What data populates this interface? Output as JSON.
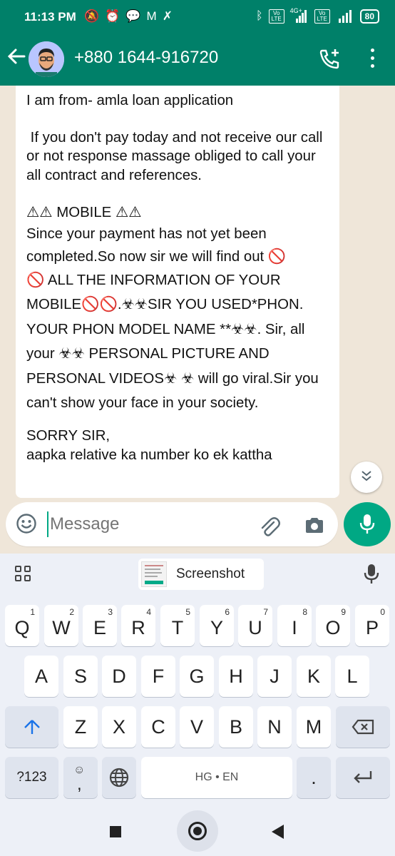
{
  "status_bar": {
    "time": "11:13 PM",
    "network": "4G+",
    "volte_label": "Vo LTE",
    "battery": "80"
  },
  "header": {
    "contact": "+880 1644-916720",
    "icons": [
      "back-arrow-icon",
      "avatar",
      "add-call-icon",
      "more-options-icon"
    ]
  },
  "chat": {
    "lines": {
      "l1": "I am from-  amla loan application",
      "l2": " If you don't pay today and not receive our call or not response massage obliged to call your all contract and references.",
      "l3": "⚠⚠ MOBILE ⚠⚠",
      "l4": "Since your payment has not yet been completed.So now sir we will find out 🚫",
      "l5": "🚫 ALL THE INFORMATION OF YOUR MOBILE🚫🚫.☣☣SIR YOU USED*PHON. YOUR PHON MODEL NAME **☣☣. Sir, all your ☣☣ PERSONAL PICTURE AND PERSONAL VIDEOS☣ ☣ will go viral.Sir you can't show your face in your society.",
      "l6": "SORRY SIR,",
      "l7": "aapka relative ka number ko ek kattha"
    }
  },
  "composer": {
    "placeholder": "Message"
  },
  "keyboard": {
    "suggestion": "Screenshot",
    "row1": [
      {
        "k": "Q",
        "h": "1"
      },
      {
        "k": "W",
        "h": "2"
      },
      {
        "k": "E",
        "h": "3"
      },
      {
        "k": "R",
        "h": "4"
      },
      {
        "k": "T",
        "h": "5"
      },
      {
        "k": "Y",
        "h": "6"
      },
      {
        "k": "U",
        "h": "7"
      },
      {
        "k": "I",
        "h": "8"
      },
      {
        "k": "O",
        "h": "9"
      },
      {
        "k": "P",
        "h": "0"
      }
    ],
    "row2": [
      "A",
      "S",
      "D",
      "F",
      "G",
      "H",
      "J",
      "K",
      "L"
    ],
    "row3": [
      "Z",
      "X",
      "C",
      "V",
      "B",
      "N",
      "M"
    ],
    "symbols": "?123",
    "comma": ",",
    "space": "HG • EN",
    "period": "."
  }
}
